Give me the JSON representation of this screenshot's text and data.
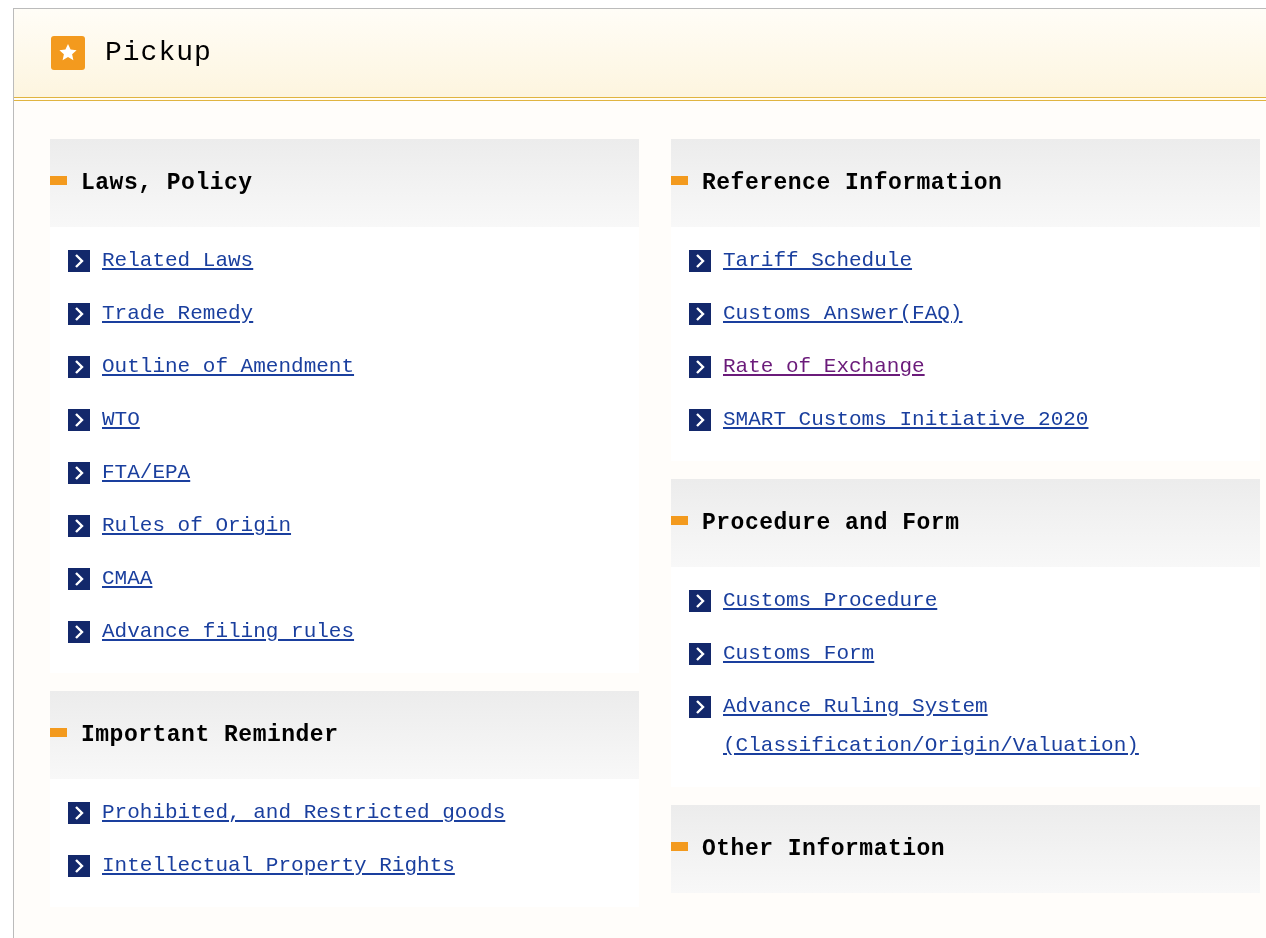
{
  "panel": {
    "title": "Pickup"
  },
  "columns": [
    {
      "sections": [
        {
          "title": "Laws, Policy",
          "links": [
            {
              "label": "Related Laws",
              "visited": false
            },
            {
              "label": "Trade Remedy",
              "visited": false
            },
            {
              "label": "Outline of Amendment",
              "visited": false
            },
            {
              "label": "WTO",
              "visited": false
            },
            {
              "label": "FTA/EPA",
              "visited": false
            },
            {
              "label": "Rules of Origin",
              "visited": false
            },
            {
              "label": "CMAA",
              "visited": false
            },
            {
              "label": "Advance filing rules",
              "visited": false
            }
          ]
        },
        {
          "title": "Important Reminder",
          "links": [
            {
              "label": "Prohibited, and Restricted goods",
              "visited": false
            },
            {
              "label": "Intellectual Property Rights",
              "visited": false
            }
          ]
        }
      ]
    },
    {
      "sections": [
        {
          "title": "Reference Information",
          "links": [
            {
              "label": "Tariff Schedule",
              "visited": false
            },
            {
              "label": "Customs Answer(FAQ)",
              "visited": false
            },
            {
              "label": "Rate of Exchange",
              "visited": true
            },
            {
              "label": "SMART Customs Initiative 2020",
              "visited": false
            }
          ]
        },
        {
          "title": "Procedure and Form",
          "links": [
            {
              "label": "Customs Procedure",
              "visited": false
            },
            {
              "label": "Customs Form",
              "visited": false
            },
            {
              "label": "Advance Ruling System (Classification/Origin/Valuation)",
              "visited": false
            }
          ]
        },
        {
          "title": "Other Information"
        }
      ]
    }
  ]
}
